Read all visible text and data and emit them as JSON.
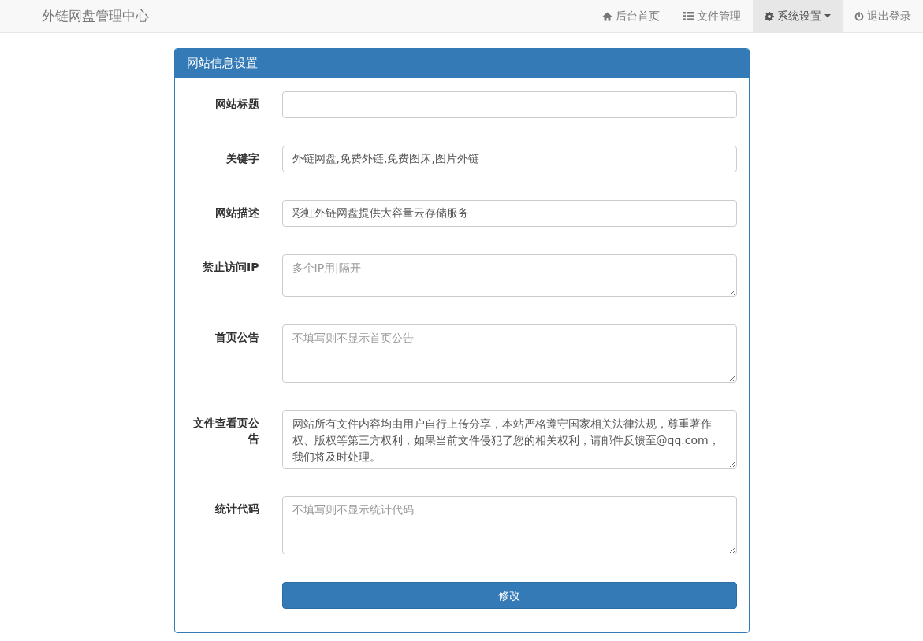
{
  "navbar": {
    "brand": "外链网盘管理中心",
    "items": [
      {
        "kind": "home",
        "label": "后台首页",
        "selected": false,
        "dropdown": false
      },
      {
        "kind": "list",
        "label": "文件管理",
        "selected": false,
        "dropdown": false
      },
      {
        "kind": "gear",
        "label": "系统设置",
        "selected": true,
        "dropdown": true
      },
      {
        "kind": "power",
        "label": "退出登录",
        "selected": false,
        "dropdown": false
      }
    ]
  },
  "panel": {
    "title": "网站信息设置",
    "fields": [
      {
        "kind": "input",
        "label": "网站标题"
      },
      {
        "kind": "input",
        "label": "关键字",
        "value": "外链网盘,免费外链,免费图床,图片外链"
      },
      {
        "kind": "input",
        "label": "网站描述",
        "value": "彩虹外链网盘提供大容量云存储服务"
      },
      {
        "kind": "short-textarea",
        "label": "禁止访问IP",
        "placeholder": "多个IP用|隔开"
      },
      {
        "kind": "textarea",
        "label": "首页公告",
        "placeholder": "不填写则不显示首页公告"
      },
      {
        "kind": "textarea",
        "label": "文件查看页公告",
        "value": "网站所有文件内容均由用户自行上传分享，本站严格遵守国家相关法律法规，尊重著作权、版权等第三方权利，如果当前文件侵犯了您的相关权利，请邮件反馈至@qq.com，我们将及时处理。"
      },
      {
        "kind": "textarea",
        "label": "统计代码",
        "placeholder": "不填写则不显示统计代码"
      }
    ],
    "submit": "修改"
  }
}
